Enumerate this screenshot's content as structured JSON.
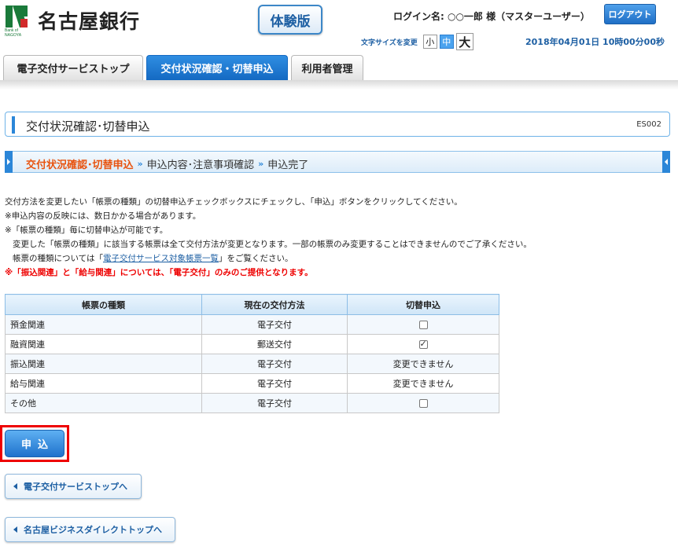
{
  "header": {
    "bank_name": "名古屋銀行",
    "logo_sub_1": "Bank of",
    "logo_sub_2": "NAGOYA",
    "trial_label": "体験版",
    "login_text": "ログイン名: ○○一郎 様（マスターユーザー）",
    "logout_label": "ログアウト",
    "font_size_label": "文字サイズを変更",
    "font_sizes": [
      "小",
      "中",
      "大"
    ],
    "font_size_selected": "中",
    "datetime": "2018年04月01日 10時00分00秒"
  },
  "tabs": [
    {
      "label": "電子交付サービストップ",
      "active": false
    },
    {
      "label": "交付状況確認・切替申込",
      "active": true
    },
    {
      "label": "利用者管理",
      "active": false
    }
  ],
  "page": {
    "title": "交付状況確認･切替申込",
    "code": "ES002"
  },
  "steps": [
    {
      "label": "交付状況確認･切替申込",
      "current": true
    },
    {
      "label": "申込内容･注意事項確認",
      "current": false
    },
    {
      "label": "申込完了",
      "current": false
    }
  ],
  "step_separator": "»",
  "instructions": {
    "line1": "交付方法を変更したい「帳票の種類」の切替申込チェックボックスにチェックし、「申込」ボタンをクリックしてください。",
    "line2": "※申込内容の反映には、数日かかる場合があります。",
    "line3": "※「帳票の種類」毎に切替申込が可能です。",
    "line4": "変更した「帳票の種類」に該当する帳票は全て交付方法が変更となります。一部の帳票のみ変更することはできませんのでご了承ください。",
    "line5_pre": "帳票の種類については「",
    "line5_link": "電子交付サービス対象帳票一覧",
    "line5_post": "」をご覧ください。",
    "warning": "※「振込関連」と「給与関連」については、「電子交付」のみのご提供となります。"
  },
  "table": {
    "headers": [
      "帳票の種類",
      "現在の交付方法",
      "切替申込"
    ],
    "rows": [
      {
        "kind": "預金関連",
        "method": "電子交付",
        "switch": "checkbox",
        "checked": false
      },
      {
        "kind": "融資関連",
        "method": "郵送交付",
        "switch": "checkbox",
        "checked": true
      },
      {
        "kind": "振込関連",
        "method": "電子交付",
        "switch": "変更できません"
      },
      {
        "kind": "給与関連",
        "method": "電子交付",
        "switch": "変更できません"
      },
      {
        "kind": "その他",
        "method": "電子交付",
        "switch": "checkbox",
        "checked": false
      }
    ]
  },
  "buttons": {
    "apply": "申込",
    "back_top": "電子交付サービストップへ",
    "back_direct": "名古屋ビジネスダイレクトトップへ"
  },
  "colors": {
    "accent": "#2b86d8",
    "step_current": "#e8530f",
    "warning": "#ee0000",
    "logo_green": "#1a7a3a"
  }
}
